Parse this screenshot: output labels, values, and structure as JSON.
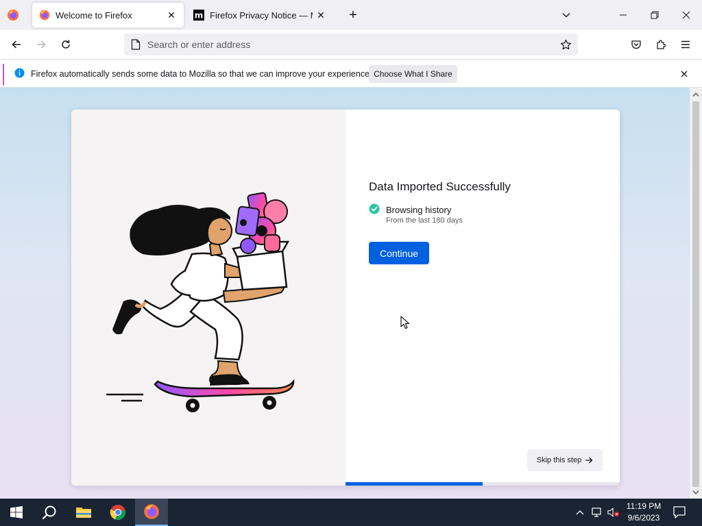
{
  "tabs": [
    {
      "title": "Welcome to Firefox",
      "active": true
    },
    {
      "title": "Firefox Privacy Notice — Mozilla",
      "active": false
    }
  ],
  "urlbar": {
    "placeholder": "Search or enter address",
    "value": ""
  },
  "notification": {
    "message": "Firefox automatically sends some data to Mozilla so that we can improve your experience.",
    "button_label": "Choose What I Share"
  },
  "onboarding": {
    "headline": "Data Imported Successfully",
    "imported_items": [
      {
        "title": "Browsing history",
        "subtitle": "From the last 180 days"
      }
    ],
    "primary_button": "Continue",
    "skip_button": "Skip this step",
    "progress_fraction": 0.5
  },
  "taskbar": {
    "apps": [
      "start",
      "search",
      "file-explorer",
      "chrome",
      "firefox"
    ],
    "active_app": "firefox",
    "time": "11:19 PM",
    "date": "9/6/2023"
  },
  "colors": {
    "accent_blue": "#0061e0",
    "check_green": "#2ac3a2",
    "taskbar_bg": "#1a2433"
  }
}
